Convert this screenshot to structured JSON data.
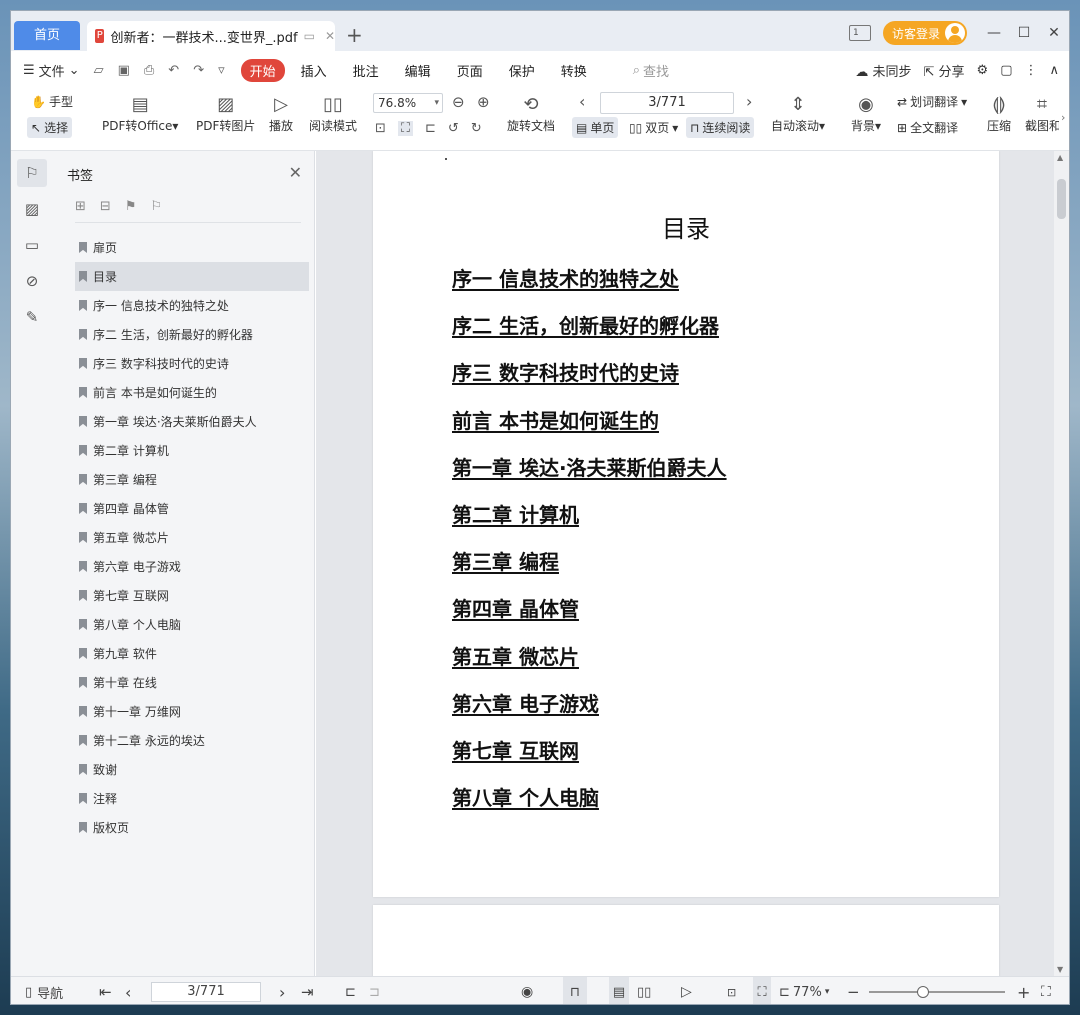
{
  "tabs": {
    "home": "首页",
    "doc_title": "创新者：一群技术...变世界_.pdf",
    "pdf_badge": "P"
  },
  "titlebar": {
    "login": "访客登录"
  },
  "menubar": {
    "file": "文件",
    "tabs": [
      "开始",
      "插入",
      "批注",
      "编辑",
      "页面",
      "保护",
      "转换"
    ],
    "search": "查找",
    "sync": "未同步",
    "share": "分享"
  },
  "toolbar": {
    "hand": "手型",
    "select": "选择",
    "pdf_to_office": "PDF转Office",
    "pdf_to_image": "PDF转图片",
    "play": "播放",
    "read_mode": "阅读模式",
    "zoom": "76.8%",
    "page": "3/771",
    "rotate": "旋转文档",
    "single": "单页",
    "double": "双页",
    "continuous": "连续阅读",
    "auto_scroll": "自动滚动",
    "background": "背景",
    "word_translate": "划词翻译",
    "full_translate": "全文翻译",
    "compress": "压缩",
    "screenshot": "截图和"
  },
  "bookmarks": {
    "title": "书签",
    "selected_index": 1,
    "items": [
      "扉页",
      "目录",
      "序一 信息技术的独特之处",
      "序二 生活，创新最好的孵化器",
      "序三 数字科技时代的史诗",
      "前言 本书是如何诞生的",
      "第一章 埃达·洛夫莱斯伯爵夫人",
      "第二章 计算机",
      "第三章 编程",
      "第四章 晶体管",
      "第五章 微芯片",
      "第六章 电子游戏",
      "第七章 互联网",
      "第八章 个人电脑",
      "第九章 软件",
      "第十章 在线",
      "第十一章 万维网",
      "第十二章 永远的埃达",
      "致谢",
      "注释",
      "版权页"
    ]
  },
  "document": {
    "toc_title": "目录",
    "toc_entries": [
      "序一 信息技术的独特之处",
      "序二 生活，创新最好的孵化器",
      "序三 数字科技时代的史诗",
      "前言 本书是如何诞生的",
      "第一章 埃达·洛夫莱斯伯爵夫人",
      "第二章 计算机",
      "第三章 编程",
      "第四章 晶体管",
      "第五章 微芯片",
      "第六章 电子游戏",
      "第七章 互联网",
      "第八章 个人电脑"
    ]
  },
  "statusbar": {
    "nav": "导航",
    "page": "3/771",
    "zoom": "77%"
  }
}
